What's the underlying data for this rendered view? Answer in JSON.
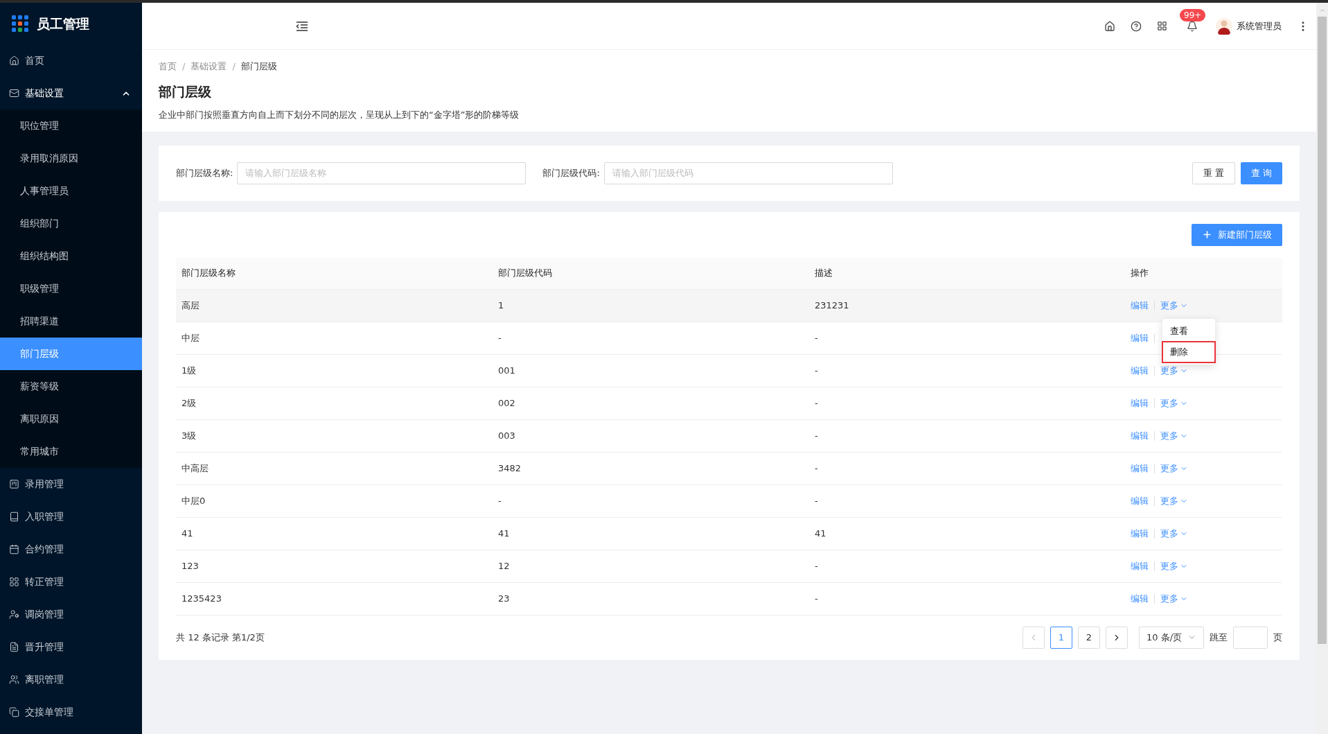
{
  "app": {
    "title": "员工管理"
  },
  "sidebar": {
    "items": [
      {
        "label": "首页"
      },
      {
        "label": "基础设置",
        "expanded": true,
        "children": [
          {
            "label": "职位管理",
            "selected": false
          },
          {
            "label": "录用取消原因",
            "selected": false
          },
          {
            "label": "人事管理员",
            "selected": false
          },
          {
            "label": "组织部门",
            "selected": false
          },
          {
            "label": "组织结构图",
            "selected": false
          },
          {
            "label": "职级管理",
            "selected": false
          },
          {
            "label": "招聘渠道",
            "selected": false
          },
          {
            "label": "部门层级",
            "selected": true
          },
          {
            "label": "薪资等级",
            "selected": false
          },
          {
            "label": "离职原因",
            "selected": false
          },
          {
            "label": "常用城市",
            "selected": false
          }
        ]
      },
      {
        "label": "录用管理"
      },
      {
        "label": "入职管理"
      },
      {
        "label": "合约管理"
      },
      {
        "label": "转正管理"
      },
      {
        "label": "调岗管理"
      },
      {
        "label": "晋升管理"
      },
      {
        "label": "离职管理"
      },
      {
        "label": "交接单管理"
      }
    ]
  },
  "header": {
    "notification_badge": "99+",
    "user": "系统管理员"
  },
  "breadcrumb": {
    "items": [
      "首页",
      "基础设置",
      "部门层级"
    ],
    "separator": "/"
  },
  "page": {
    "title": "部门层级",
    "description": "企业中部门按照垂直方向自上而下划分不同的层次，呈现从上到下的“金字塔”形的阶梯等级"
  },
  "filters": [
    {
      "label": "部门层级名称:",
      "placeholder": "请输入部门层级名称"
    },
    {
      "label": "部门层级代码:",
      "placeholder": "请输入部门层级代码"
    }
  ],
  "filter_buttons": [
    "重 置",
    "查 询"
  ],
  "new_button": "新建部门层级",
  "table": {
    "columns": [
      "部门层级名称",
      "部门层级代码",
      "描述",
      "操作"
    ],
    "rows": [
      {
        "cells": [
          "高层",
          "1",
          "231231"
        ],
        "edit": "编辑",
        "more": "更多",
        "menu_open": true
      },
      {
        "cells": [
          "中层",
          "-",
          "-"
        ],
        "edit": "编辑",
        "menu_open": false
      },
      {
        "cells": [
          "1级",
          "001",
          "-"
        ],
        "edit": "编辑",
        "more": "更多",
        "menu_open": false
      },
      {
        "cells": [
          "2级",
          "002",
          "-"
        ],
        "edit": "编辑",
        "more": "更多",
        "menu_open": false
      },
      {
        "cells": [
          "3级",
          "003",
          "-"
        ],
        "edit": "编辑",
        "more": "更多",
        "menu_open": false
      },
      {
        "cells": [
          "中高层",
          "3482",
          "-"
        ],
        "edit": "编辑",
        "more": "更多",
        "menu_open": false
      },
      {
        "cells": [
          "中层0",
          "-",
          "-"
        ],
        "edit": "编辑",
        "more": "更多",
        "menu_open": false
      },
      {
        "cells": [
          "41",
          "41",
          "41"
        ],
        "edit": "编辑",
        "more": "更多",
        "menu_open": false
      },
      {
        "cells": [
          "123",
          "12",
          "-"
        ],
        "edit": "编辑",
        "more": "更多",
        "menu_open": false
      },
      {
        "cells": [
          "1235423",
          "23",
          "-"
        ],
        "edit": "编辑",
        "more": "更多",
        "menu_open": false
      }
    ]
  },
  "dropdown": {
    "items": [
      {
        "label": "查看",
        "highlighted": false
      },
      {
        "label": "删除",
        "highlighted": true
      }
    ]
  },
  "pagination": {
    "summary": "共 12 条记录 第1/2页",
    "pages": [
      {
        "label": "1",
        "selected": true
      },
      {
        "label": "2",
        "selected": false
      }
    ],
    "page_size": "10 条/页",
    "jump_label": "跳至",
    "page_suffix": "页"
  }
}
